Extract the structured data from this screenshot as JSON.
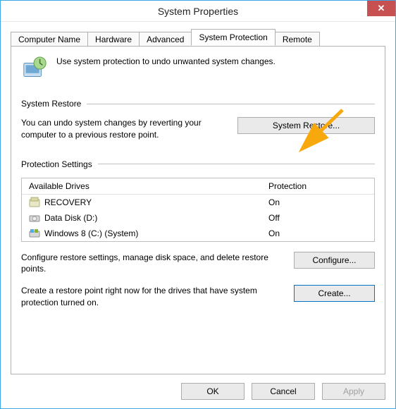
{
  "window": {
    "title": "System Properties"
  },
  "tabs": [
    {
      "label": "Computer Name"
    },
    {
      "label": "Hardware"
    },
    {
      "label": "Advanced"
    },
    {
      "label": "System Protection"
    },
    {
      "label": "Remote"
    }
  ],
  "intro_text": "Use system protection to undo unwanted system changes.",
  "system_restore": {
    "header": "System Restore",
    "desc": "You can undo system changes by reverting your computer to a previous restore point.",
    "button": "System Restore..."
  },
  "protection_settings": {
    "header": "Protection Settings",
    "col_drive": "Available Drives",
    "col_protection": "Protection",
    "drives": [
      {
        "name": "RECOVERY",
        "status": "On",
        "icon": "drive"
      },
      {
        "name": "Data Disk (D:)",
        "status": "Off",
        "icon": "disk"
      },
      {
        "name": "Windows 8 (C:) (System)",
        "status": "On",
        "icon": "windows"
      }
    ],
    "configure_desc": "Configure restore settings, manage disk space, and delete restore points.",
    "configure_btn": "Configure...",
    "create_desc": "Create a restore point right now for the drives that have system protection turned on.",
    "create_btn": "Create..."
  },
  "footer": {
    "ok": "OK",
    "cancel": "Cancel",
    "apply": "Apply"
  }
}
